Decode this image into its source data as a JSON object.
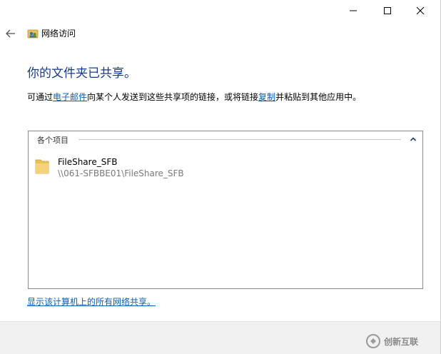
{
  "window": {
    "breadcrumb": "网络访问",
    "controls": {
      "minimize": "─",
      "maximize": "□",
      "close": "✕"
    }
  },
  "main": {
    "heading": "你的文件夹已共享。",
    "desc_prefix": "可通过",
    "desc_email_link": "电子邮件",
    "desc_middle": "向某个人发送到这些共享项的链接，或将链接",
    "desc_copy_link": "复制",
    "desc_suffix": "并粘贴到其他应用中。"
  },
  "panel": {
    "group_title": "各个项目",
    "items": [
      {
        "name": "FileShare_SFB",
        "path": "\\\\061-SFBBE01\\FileShare_SFB"
      }
    ]
  },
  "footer": {
    "show_all_link": "显示该计算机上的所有网络共享。"
  },
  "watermark": {
    "text": "创新互联"
  },
  "icons": {
    "back": "back-arrow-icon",
    "network": "network-share-icon",
    "folder": "folder-icon",
    "chevron": "chevron-up-icon"
  },
  "colors": {
    "heading": "#143c8c",
    "link": "#0b5db6",
    "folder": "#e8c15a"
  }
}
